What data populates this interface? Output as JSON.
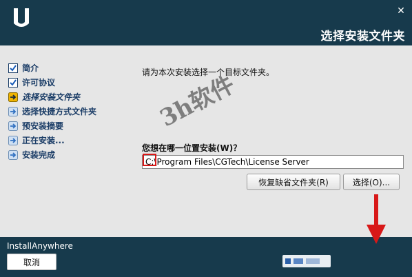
{
  "header": {
    "title": "选择安装文件夹",
    "close_label": "✕"
  },
  "sidebar": {
    "steps": [
      {
        "label": "简介",
        "state": "done"
      },
      {
        "label": "许可协议",
        "state": "done"
      },
      {
        "label": "选择安装文件夹",
        "state": "current"
      },
      {
        "label": "选择快捷方式文件夹",
        "state": "pending"
      },
      {
        "label": "预安装摘要",
        "state": "pending"
      },
      {
        "label": "正在安装...",
        "state": "pending"
      },
      {
        "label": "安装完成",
        "state": "pending"
      }
    ]
  },
  "main": {
    "prompt": "请为本次安装选择一个目标文件夹。",
    "question": "您想在哪一位置安装(W)？",
    "path_value": "C:\\Program Files\\CGTech\\License Server",
    "restore_button": "恢复缺省文件夹(R)",
    "choose_button": "选择(O)..."
  },
  "footer": {
    "vendor": "InstallAnywhere",
    "cancel_button": "取消"
  },
  "watermark": {
    "text": "3h软件"
  },
  "colors": {
    "chrome": "#173a4c",
    "panel": "#e6e6e6",
    "step_text": "#1a3c66",
    "annotation": "#d81818"
  }
}
